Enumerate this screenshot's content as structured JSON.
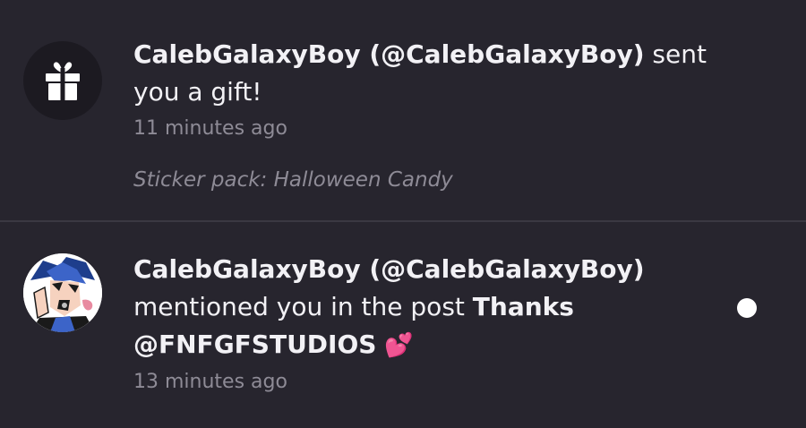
{
  "notifications": [
    {
      "type": "gift",
      "icon": "gift-icon",
      "user": "CalebGalaxyBoy (@CalebGalaxyBoy)",
      "action": " sent you a gift!",
      "time": "11 minutes ago",
      "note": "Sticker pack: Halloween Candy",
      "unread": false
    },
    {
      "type": "mention",
      "icon": "user-avatar",
      "user": "CalebGalaxyBoy (@CalebGalaxyBoy)",
      "action": " mentioned you in the post ",
      "post_title": "Thanks @FNFGFSTUDIOS",
      "emoji": "💕",
      "time": "13 minutes ago",
      "unread": true
    }
  ],
  "colors": {
    "background": "#27252e",
    "text_primary": "#f2f1f5",
    "text_secondary": "#8e8b96",
    "unread_dot": "#ffffff"
  }
}
